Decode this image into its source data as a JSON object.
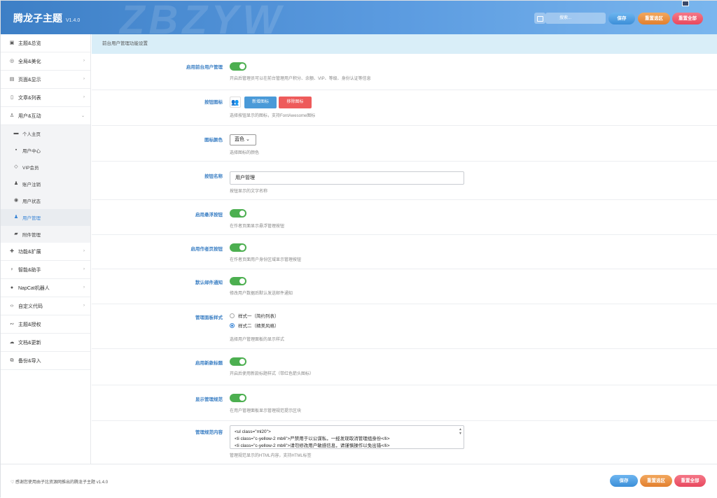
{
  "header": {
    "title": "腾龙子主题",
    "version": "V1.4.0",
    "watermark": "ZBZYW",
    "search_placeholder": "搜索...",
    "save": "保存",
    "reset_section": "重置选区",
    "reset_all": "重置全部"
  },
  "sidebar": {
    "items": [
      {
        "label": "主题&总览",
        "icon": "dashboard-icon"
      },
      {
        "label": "全局&美化",
        "icon": "globe-icon",
        "chevron": "›"
      },
      {
        "label": "页面&显示",
        "icon": "page-icon",
        "chevron": "›"
      },
      {
        "label": "文章&列表",
        "icon": "book-icon",
        "chevron": "›"
      },
      {
        "label": "用户&互动",
        "icon": "user-icon",
        "chevron": "⌄"
      }
    ],
    "sub_items": [
      {
        "label": "个人主页",
        "icon": "id-card-icon"
      },
      {
        "label": "用户中心",
        "icon": "user-box-icon"
      },
      {
        "label": "VIP会员",
        "icon": "diamond-icon"
      },
      {
        "label": "账户注销",
        "icon": "user-remove-icon"
      },
      {
        "label": "用户状态",
        "icon": "user-circle-icon"
      },
      {
        "label": "用户管理",
        "icon": "users-icon",
        "active": true
      },
      {
        "label": "附件管理",
        "icon": "folder-icon"
      }
    ],
    "items_after": [
      {
        "label": "功能&扩展",
        "icon": "puzzle-icon",
        "chevron": "›"
      },
      {
        "label": "智能&助手",
        "icon": "bulb-icon",
        "chevron": "›"
      },
      {
        "label": "NapCat机器人",
        "icon": "robot-icon",
        "chevron": "›"
      },
      {
        "label": "自定义代码",
        "icon": "code-icon",
        "chevron": "›"
      },
      {
        "label": "主题&授权",
        "icon": "handshake-icon"
      },
      {
        "label": "文档&更新",
        "icon": "cloud-icon"
      },
      {
        "label": "备份&导入",
        "icon": "backup-icon"
      }
    ]
  },
  "main": {
    "section_title": "前台用户管理功能设置",
    "fields": {
      "f1": {
        "label": "启用前台用户管理",
        "desc": "开启后管理员可以在前台管理用户积分、余额、VIP、等级、身份认证等信息"
      },
      "f2": {
        "label": "按钮图标",
        "add": "新增图标",
        "remove": "移除图标",
        "desc": "选择按钮显示的图标，支持FontAwesome图标",
        "icon_glyph": "👥"
      },
      "f3": {
        "label": "图标颜色",
        "value": "蓝色",
        "desc": "选择图标的颜色"
      },
      "f4": {
        "label": "按钮名称",
        "value": "用户管理",
        "desc": "按钮显示的文字名称"
      },
      "f5": {
        "label": "启用悬浮按钮",
        "desc": "在作者页面显示悬浮管理按钮"
      },
      "f6": {
        "label": "启用作者页按钮",
        "desc": "在作者页面用户身份区域显示管理按钮"
      },
      "f7": {
        "label": "默认邮件通知",
        "desc": "修改用户数据后默认发送邮件通知"
      },
      "f8": {
        "label": "管理面板样式",
        "opt1": "样式一（简约列表）",
        "opt2": "样式二（精美风格）",
        "desc": "选择用户管理面板的显示样式"
      },
      "f9": {
        "label": "启用新款标题",
        "desc": "开启后使用新款标题样式（带红色箭头图标）"
      },
      "f10": {
        "label": "显示管理规范",
        "desc": "在用户管理面板显示管理规范提示区块"
      },
      "f11": {
        "label": "管理规范内容",
        "line1": "<ul class=\"ml20\">",
        "line2": "<li class=\"c-yellow-2 mb6\">严禁用于以公谋私，一经发现取消管理组身份</li>",
        "line3": "<li class=\"c-yellow-2 mb6\">请勿修改用户敏感信息，请谨慎操作以免出错</li>",
        "desc": "管理规范显示的HTML内容，支持HTML标签"
      }
    }
  },
  "footer": {
    "text": "感谢您使用由子比资源网推出的腾龙子主题 v1.4.0",
    "save": "保存",
    "reset_section": "重置选区",
    "reset_all": "重置全部"
  },
  "colors": {
    "accent": "#3b86d6",
    "toggle_on": "#4caf50",
    "header_start": "#3d7fc6",
    "orange": "#e27f2e",
    "red": "#e8485e"
  }
}
